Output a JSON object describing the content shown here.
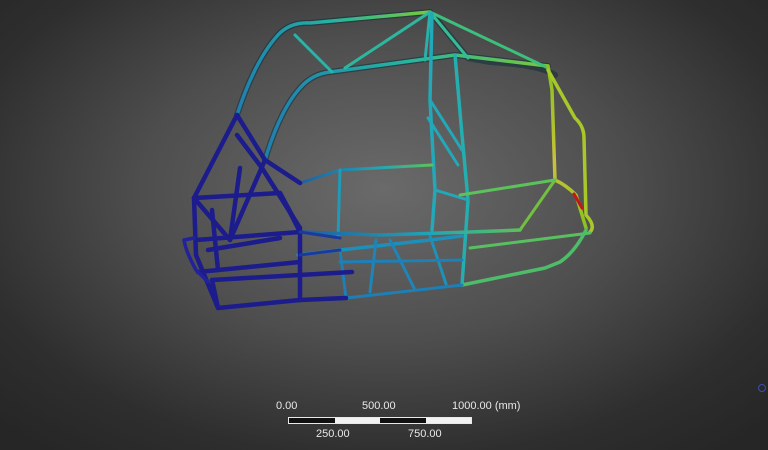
{
  "viewport": {
    "name": "3D frame deformation result view"
  },
  "scale_bar": {
    "top_labels": [
      "0.00",
      "500.00",
      "1000.00 (mm)"
    ],
    "bottom_labels": [
      "250.00",
      "750.00"
    ]
  },
  "colors": {
    "frame_low": "#1a1a8a",
    "frame_mid": "#1fa3b8",
    "frame_high": "#8ac21a",
    "frame_peak": "#c8c23a",
    "frame_max": "#c01818"
  }
}
